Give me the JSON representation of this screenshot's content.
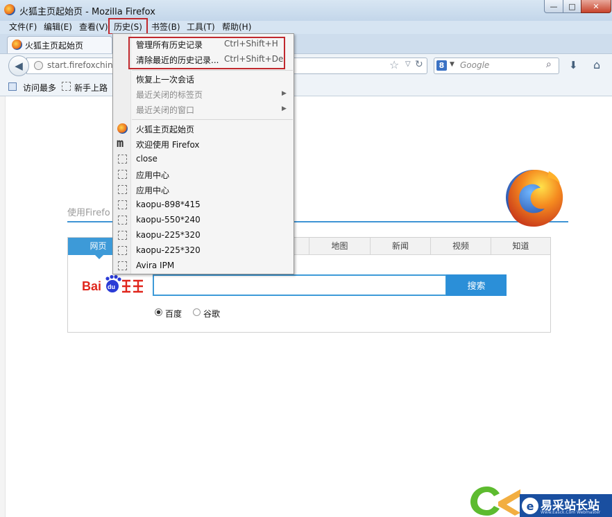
{
  "window": {
    "title": "火狐主页起始页 - Mozilla Firefox",
    "min_glyph": "—",
    "max_glyph": "□",
    "close_glyph": "✕"
  },
  "menubar": {
    "items": [
      "文件(F)",
      "编辑(E)",
      "查看(V)",
      "历史(S)",
      "书签(B)",
      "工具(T)",
      "帮助(H)"
    ]
  },
  "tab": {
    "label": "火狐主页起始页"
  },
  "nav": {
    "back_glyph": "◀",
    "url": "start.firefoxchina",
    "star_glyph": "☆",
    "drop_glyph": "▽",
    "reload_glyph": "↻",
    "search_engine_glyph": "8",
    "search_drop_glyph": "▼",
    "search_placeholder": "Google",
    "search_glyph": "⌕",
    "download_glyph": "⬇",
    "home_glyph": "⌂"
  },
  "bookmarks": {
    "items": [
      "访问最多",
      "新手上路"
    ]
  },
  "page": {
    "hint": "使用Firefo",
    "categories": [
      "网页",
      "地图",
      "新闻",
      "视频",
      "知道"
    ],
    "search_button": "搜索",
    "radio_options": [
      "百度",
      "谷歌"
    ],
    "selected_engine": "百度"
  },
  "history_menu": {
    "manage": {
      "label": "管理所有历史记录",
      "shortcut": "Ctrl+Shift+H"
    },
    "clear": {
      "label": "清除最近的历史记录...",
      "shortcut": "Ctrl+Shift+Del"
    },
    "restore": "恢复上一次会话",
    "recent_tabs": "最近关闭的标签页",
    "recent_windows": "最近关闭的窗口",
    "submenu_arrow": "▶",
    "history_entries": [
      "火狐主页起始页",
      "欢迎使用 Firefox",
      "close",
      "应用中心",
      "应用中心",
      "kaopu-898*415",
      "kaopu-550*240",
      "kaopu-225*320",
      "kaopu-225*320",
      "Avira IPM"
    ],
    "m_icon_glyph": "m"
  },
  "watermark": {
    "right_logo_glyph": "e",
    "right_text": "易采站长站",
    "right_sub": "Www.Easck.Com Webmaster"
  },
  "colors": {
    "accent_blue": "#3d9ad8",
    "highlight_red": "#c0282d",
    "menubar_bg": "#d6e4f2"
  }
}
